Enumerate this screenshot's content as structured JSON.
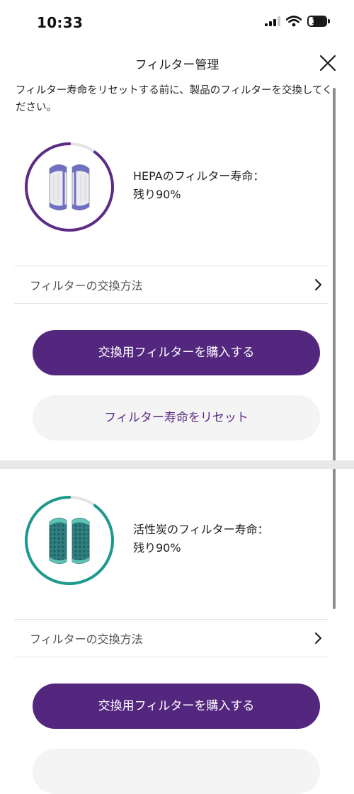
{
  "status_bar": {
    "time": "10:33",
    "battery": "30",
    "battery_level": 0.3
  },
  "header": {
    "title": "フィルター管理"
  },
  "intro_text": "フィルター寿命をリセットする前に、製品のフィルターを交換してください。",
  "filters": [
    {
      "life_label": "HEPAのフィルター寿命：",
      "remaining": "残り90%",
      "remaining_fraction": 0.9,
      "ring_color": "#5b2b86",
      "how_to_label": "フィルターの交換方法",
      "buy_label": "交換用フィルターを購入する",
      "reset_label": "フィルター寿命をリセット"
    },
    {
      "life_label": "活性炭のフィルター寿命：",
      "remaining": "残り90%",
      "remaining_fraction": 0.9,
      "ring_color": "#1c9a8d",
      "how_to_label": "フィルターの交換方法",
      "buy_label": "交換用フィルターを購入する"
    }
  ],
  "colors": {
    "accent": "#54277f",
    "secondary_bg": "#f4f4f4",
    "divider": "#e8e8e8"
  },
  "icons": [
    "signal-icon",
    "wifi-icon",
    "battery-icon",
    "close-icon",
    "hepa-filter-icon",
    "carbon-filter-icon",
    "chevron-right-icon"
  ]
}
